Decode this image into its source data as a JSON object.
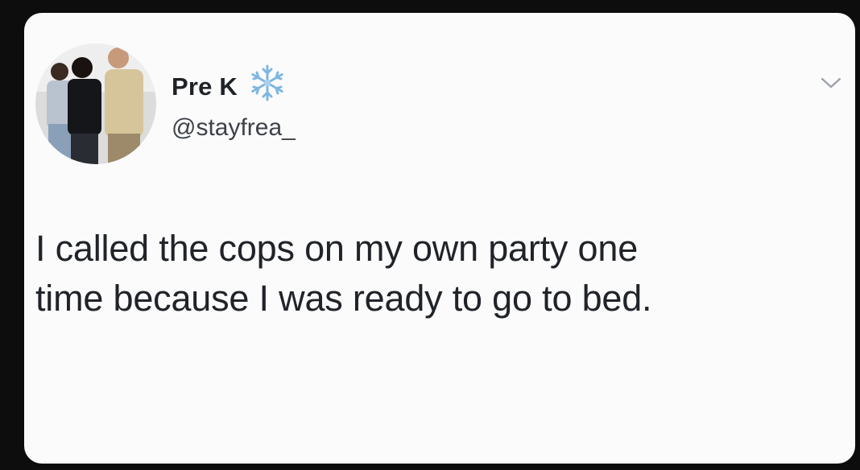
{
  "tweet": {
    "display_name": "Pre K",
    "badge_icon": "snowflake-icon",
    "handle": "@stayfrea_",
    "menu_icon": "chevron-down-icon",
    "text_lines": [
      "I called the cops on my own party one",
      "time because I was ready to go to bed."
    ]
  },
  "colors": {
    "background": "#0d0d0e",
    "card": "#fbfbfc",
    "text": "#202328",
    "snowflake": "#7fb6e0"
  }
}
